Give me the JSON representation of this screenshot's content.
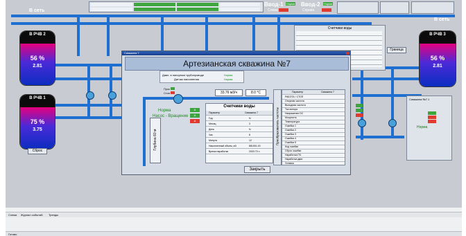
{
  "scada": {
    "net_label_left": "В сеть",
    "net_label_right": "В сеть",
    "input1_label": "Ввод-1",
    "input2_label": "Ввод-2",
    "input1_state": "Слева",
    "input2_state": "Справа",
    "input1_status": "Норма",
    "input2_status": "Норма",
    "meters_panel_title": "Счетчики воды",
    "reset_button": "Сбросить",
    "tanks": [
      {
        "title": "В РЧВ 2",
        "percent": "56 %",
        "level": "2.81"
      },
      {
        "title": "В РЧВ 1",
        "percent": "75 %",
        "level": "3.75"
      },
      {
        "title": "В РЧВ 3",
        "percent": "56 %",
        "level": "2.81"
      }
    ],
    "tank1_button": "Сброс",
    "right_panel_title": "Скважина №7.1",
    "right_button": "Граница",
    "right_status": "Норма",
    "colors": {
      "pipe": "#1f6fd0",
      "ok": "#3fa63f",
      "alarm": "#e03b2e",
      "panel": "#c8ccd2"
    }
  },
  "dialog": {
    "window_title": "Скважина 7",
    "title": "Артезианская скважина №7",
    "pressure_label": "Давл. в напорном трубопроводе",
    "pressure_value": "Норма",
    "flow_label": "Датчик наполнения",
    "flow_value": "Норма",
    "pump_left_label": "Пуск",
    "pump_left_label2": "Стоп",
    "flow_readout": "33.76 м3/ч",
    "temp_readout": "8.0 °С",
    "depth_label": "Глубина 60 м",
    "state_norm": "Норма",
    "state_pump": "Насос - Вращение",
    "alarm_a": "А",
    "meters_title": "Счетчики воды",
    "meters_headers": [
      "Параметр",
      "Скважина 7"
    ],
    "meters_rows": [
      [
        "Год",
        "N"
      ],
      [
        "Месяц",
        "3"
      ],
      [
        "День",
        "N"
      ],
      [
        "Час",
        "8"
      ],
      [
        "Минута",
        "12"
      ],
      [
        "Накопленный объем, м3",
        "881501.00"
      ],
      [
        "Время наработки",
        "2003.70 ч"
      ]
    ],
    "converter_label": "Преобразователь частоты",
    "conv_headers": [
      "Параметр",
      "Скважина 7"
    ],
    "conv_rows": [
      "РАБОТА / СТОП",
      "Опорная частота",
      "Выходная частота",
      "Ток мотора",
      "Напряжение DC",
      "Мощность",
      "Температура",
      "Ошибка 1",
      "Ошибка 2",
      "Ошибка 3",
      "Ошибка 4",
      "Ошибка 5",
      "Код ошибки",
      "Сброс ошибки",
      "Наработка ПЧ",
      "Наработка двиг.",
      "Уставка"
    ],
    "close_button": "Закрыть"
  },
  "bottom": {
    "tabs": [
      "Схема",
      "Журнал событий",
      "Тренды"
    ],
    "status": "Готово"
  }
}
